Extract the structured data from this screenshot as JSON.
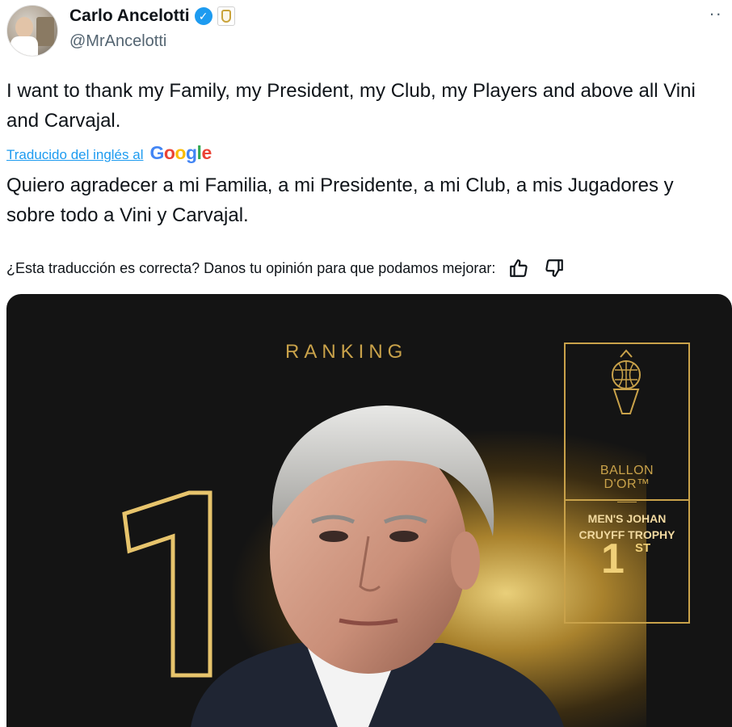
{
  "author": {
    "name": "Carlo Ancelotti",
    "handle": "@MrAncelotti",
    "verified_icon": "verified-badge-icon",
    "affiliate_icon": "real-madrid-crest-icon"
  },
  "menu": {
    "more_label": "··"
  },
  "tweet": {
    "text": "I want to thank my Family, my President, my Club, my Players and above all Vini and Carvajal.",
    "translated_label": "Traducido del inglés al",
    "translator_brand": "Google",
    "translation": "Quiero agradecer a mi Familia, a mi Presidente, a mi Club, a mis Jugadores y sobre todo a Vini y Carvajal.",
    "feedback_prompt": "¿Esta traducción es correcta? Danos tu opinión para que podamos mejorar:"
  },
  "media": {
    "ranking_label": "RANKING",
    "big_number": "1",
    "award_logo_line1": "BALLON",
    "award_logo_line2": "D'OR™",
    "trophy_name": "MEN'S JOHAN CRUYFF TROPHY",
    "position": "1",
    "position_suffix": "ST"
  },
  "colors": {
    "accent": "#1d9bf0",
    "gold": "#c9a24a",
    "media_background": "#141414"
  }
}
